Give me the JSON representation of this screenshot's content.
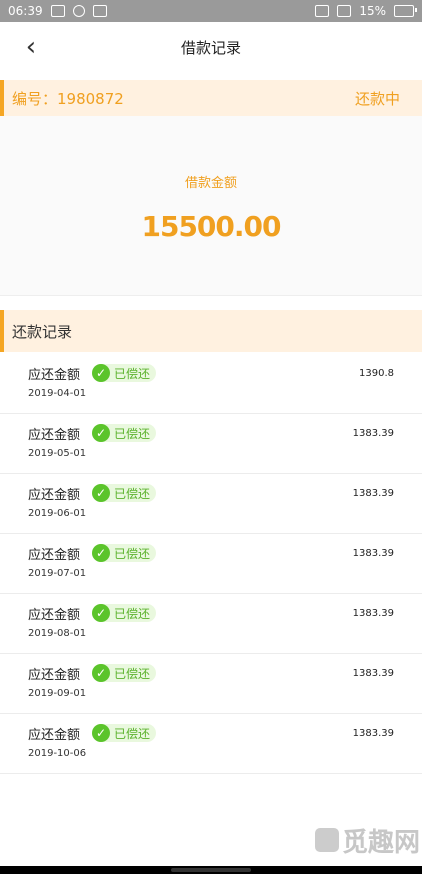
{
  "status": {
    "time": "06:39",
    "battery": "15%",
    "colors": {
      "bar": "#9a9a9a"
    }
  },
  "nav": {
    "title": "借款记录",
    "back_icon": "chevron-left-icon"
  },
  "loan": {
    "number": "编号：1980872",
    "status": "还款中"
  },
  "summary": {
    "amount_label": "借款金额",
    "amount_value": "15500.00"
  },
  "repayments": {
    "header": "还款记录",
    "items": [
      {
        "label": "应还金额",
        "status": "已偿还",
        "date": "2019-04-01",
        "amount": "1390.8"
      },
      {
        "label": "应还金额",
        "status": "已偿还",
        "date": "2019-05-01",
        "amount": "1383.39"
      },
      {
        "label": "应还金额",
        "status": "已偿还",
        "date": "2019-06-01",
        "amount": "1383.39"
      },
      {
        "label": "应还金额",
        "status": "已偿还",
        "date": "2019-07-01",
        "amount": "1383.39"
      },
      {
        "label": "应还金额",
        "status": "已偿还",
        "date": "2019-08-01",
        "amount": "1383.39"
      },
      {
        "label": "应还金额",
        "status": "已偿还",
        "date": "2019-09-01",
        "amount": "1383.39"
      },
      {
        "label": "应还金额",
        "status": "已偿还",
        "date": "2019-10-06",
        "amount": "1383.39"
      }
    ]
  },
  "watermark": {
    "text": "觅趣网"
  },
  "colors": {
    "accent": "#f5a623",
    "accent_text": "#f0a020",
    "success": "#5bc42b",
    "success_bg": "#e9f8de"
  }
}
